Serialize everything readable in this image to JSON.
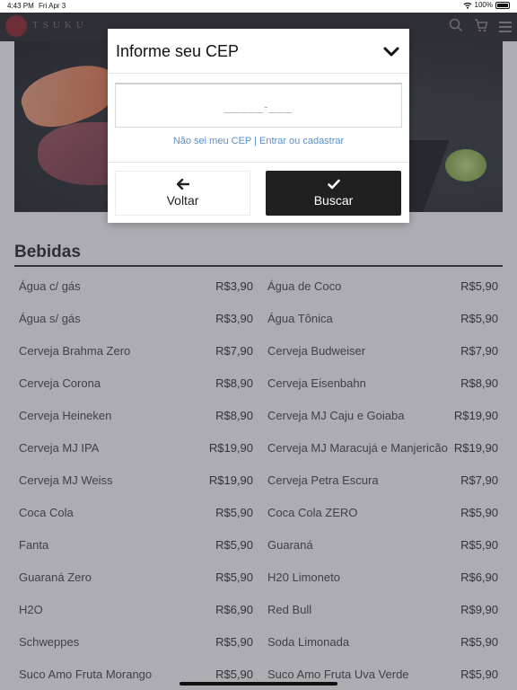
{
  "status_bar": {
    "time": "4:43 PM",
    "date": "Fri Apr 3",
    "battery": "100%"
  },
  "nav": {
    "logo_text": "TSUKU",
    "icons": [
      "search-icon",
      "cart-icon",
      "menu-icon"
    ]
  },
  "section": {
    "title": "Bebidas"
  },
  "menu": {
    "left": [
      {
        "name": "Água c/ gás",
        "price": "R$3,90"
      },
      {
        "name": "Água s/ gás",
        "price": "R$3,90"
      },
      {
        "name": "Cerveja Brahma Zero",
        "price": "R$7,90"
      },
      {
        "name": "Cerveja Corona",
        "price": "R$8,90"
      },
      {
        "name": "Cerveja Heineken",
        "price": "R$8,90"
      },
      {
        "name": "Cerveja MJ IPA",
        "price": "R$19,90"
      },
      {
        "name": "Cerveja MJ Weiss",
        "price": "R$19,90"
      },
      {
        "name": "Coca Cola",
        "price": "R$5,90"
      },
      {
        "name": "Fanta",
        "price": "R$5,90"
      },
      {
        "name": "Guaraná Zero",
        "price": "R$5,90"
      },
      {
        "name": "H2O",
        "price": "R$6,90"
      },
      {
        "name": "Schweppes",
        "price": "R$5,90"
      },
      {
        "name": "Suco Amo Fruta Morango",
        "price": "R$5,90"
      }
    ],
    "right": [
      {
        "name": "Água de Coco",
        "price": "R$5,90"
      },
      {
        "name": "Água Tônica",
        "price": "R$5,90"
      },
      {
        "name": "Cerveja Budweiser",
        "price": "R$7,90"
      },
      {
        "name": "Cerveja Eisenbahn",
        "price": "R$8,90"
      },
      {
        "name": "Cerveja MJ Caju e Goiaba",
        "price": "R$19,90"
      },
      {
        "name": "Cerveja MJ Maracujá e Manjericão",
        "price": "R$19,90"
      },
      {
        "name": "Cerveja Petra Escura",
        "price": "R$7,90"
      },
      {
        "name": "Coca Cola ZERO",
        "price": "R$5,90"
      },
      {
        "name": "Guaraná",
        "price": "R$5,90"
      },
      {
        "name": "H20 Limoneto",
        "price": "R$6,90"
      },
      {
        "name": "Red Bull",
        "price": "R$9,90"
      },
      {
        "name": "Soda Limonada",
        "price": "R$5,90"
      },
      {
        "name": "Suco Amo Fruta Uva Verde",
        "price": "R$5,90"
      }
    ]
  },
  "modal": {
    "title": "Informe seu CEP",
    "cep_placeholder": "_____-___",
    "link_unknown_cep": "Não sei meu CEP",
    "link_separator": "|",
    "link_login": "Entrar ou cadastrar",
    "back_label": "Voltar",
    "search_label": "Buscar"
  },
  "colors": {
    "nav_bg": "#1c1c1e",
    "link": "#5b8fc7",
    "primary_button": "#202020",
    "logo_red": "#8e1a1f"
  }
}
